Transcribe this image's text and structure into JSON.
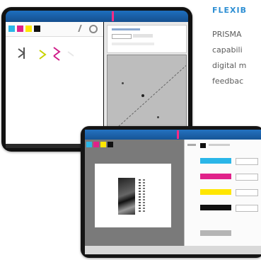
{
  "side_text": {
    "heading": "FLEXIB",
    "lines": [
      "PRISMA",
      "capabili",
      "digital m",
      "feedbac"
    ]
  },
  "colors": {
    "heading": "#2e8fd3",
    "accent": "#ff2a85",
    "cyan": "#2ab6e8",
    "magenta": "#e0228a",
    "yellow": "#ffe600",
    "black": "#111111"
  },
  "icons": [
    "cyan-swatch-icon",
    "magenta-swatch-icon",
    "yellow-swatch-icon",
    "black-swatch-icon",
    "pencil-icon",
    "gear-icon",
    "close-icon"
  ]
}
